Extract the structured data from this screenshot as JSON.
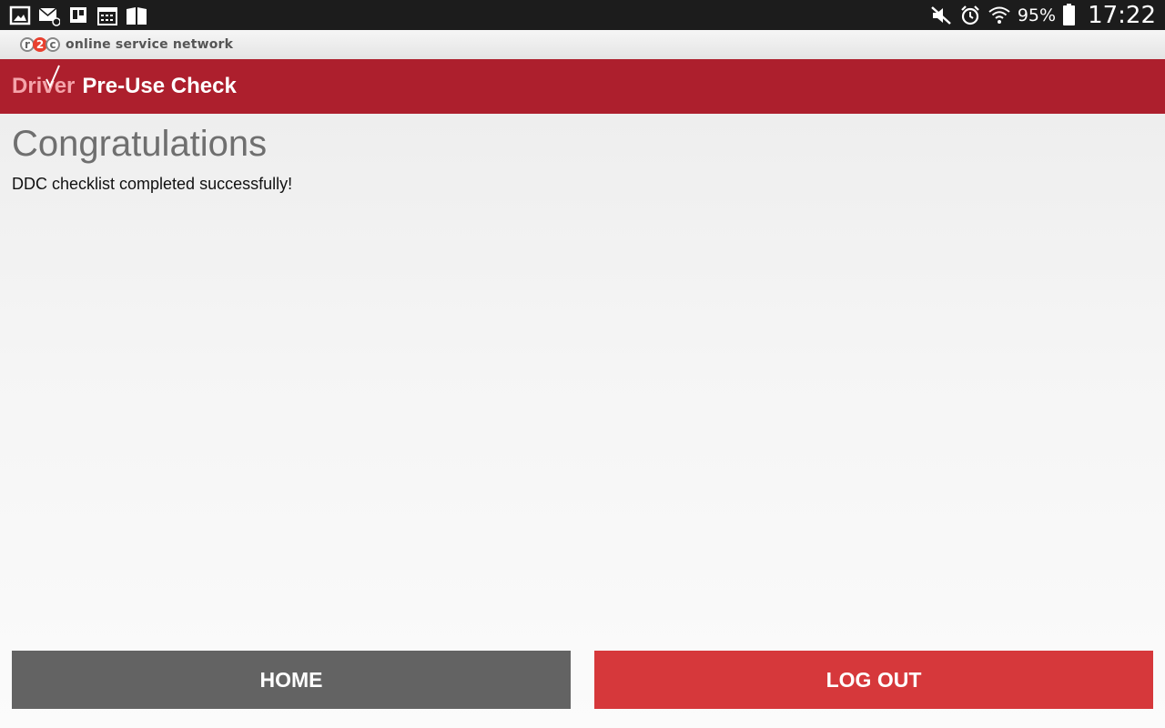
{
  "status_bar": {
    "left_icons": [
      "gallery-icon",
      "email-icon",
      "trello-icon",
      "calendar-icon",
      "book-icon"
    ],
    "right_icons": [
      "mute-icon",
      "alarm-icon",
      "wifi-icon"
    ],
    "battery_percent": "95%",
    "time": "17:22"
  },
  "brand": {
    "logo_letters": [
      "r",
      "2",
      "c"
    ],
    "tagline": "online service network",
    "accent_color": "#e8402f"
  },
  "header": {
    "brand_word": "Driver",
    "title": "Pre-Use Check",
    "background_color": "#ad1f2d"
  },
  "main": {
    "heading": "Congratulations",
    "message": "DDC checklist completed successfully!"
  },
  "actions": {
    "home_label": "HOME",
    "logout_label": "LOG OUT",
    "home_color": "#636363",
    "logout_color": "#d6383b"
  }
}
